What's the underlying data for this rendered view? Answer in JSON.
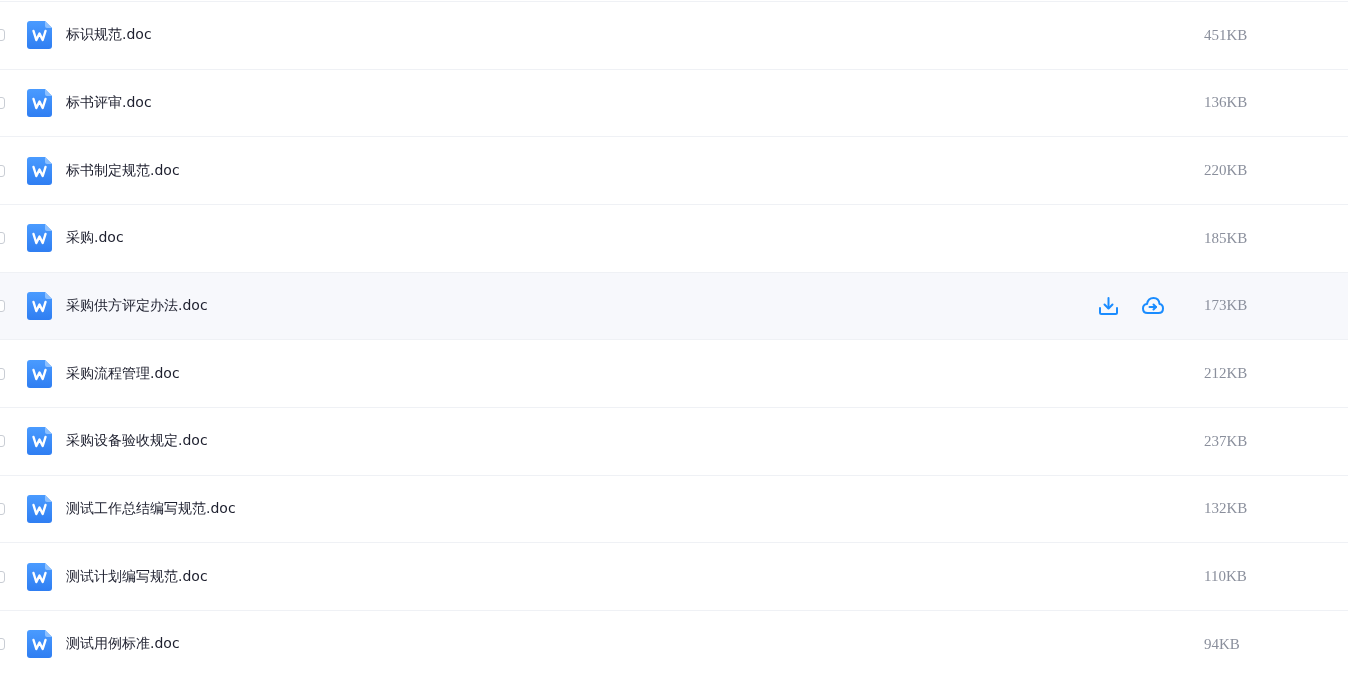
{
  "files": [
    {
      "name": "标识规范.doc",
      "size": "451KB",
      "checked": false,
      "hovered": false
    },
    {
      "name": "标书评审.doc",
      "size": "136KB",
      "checked": false,
      "hovered": false
    },
    {
      "name": "标书制定规范.doc",
      "size": "220KB",
      "checked": false,
      "hovered": false
    },
    {
      "name": "采购.doc",
      "size": "185KB",
      "checked": false,
      "hovered": false
    },
    {
      "name": "采购供方评定办法.doc",
      "size": "173KB",
      "checked": false,
      "hovered": true
    },
    {
      "name": "采购流程管理.doc",
      "size": "212KB",
      "checked": false,
      "hovered": false
    },
    {
      "name": "采购设备验收规定.doc",
      "size": "237KB",
      "checked": false,
      "hovered": false
    },
    {
      "name": "测试工作总结编写规范.doc",
      "size": "132KB",
      "checked": false,
      "hovered": false
    },
    {
      "name": "测试计划编写规范.doc",
      "size": "110KB",
      "checked": false,
      "hovered": false
    },
    {
      "name": "测试用例标准.doc",
      "size": "94KB",
      "checked": false,
      "hovered": false
    }
  ]
}
